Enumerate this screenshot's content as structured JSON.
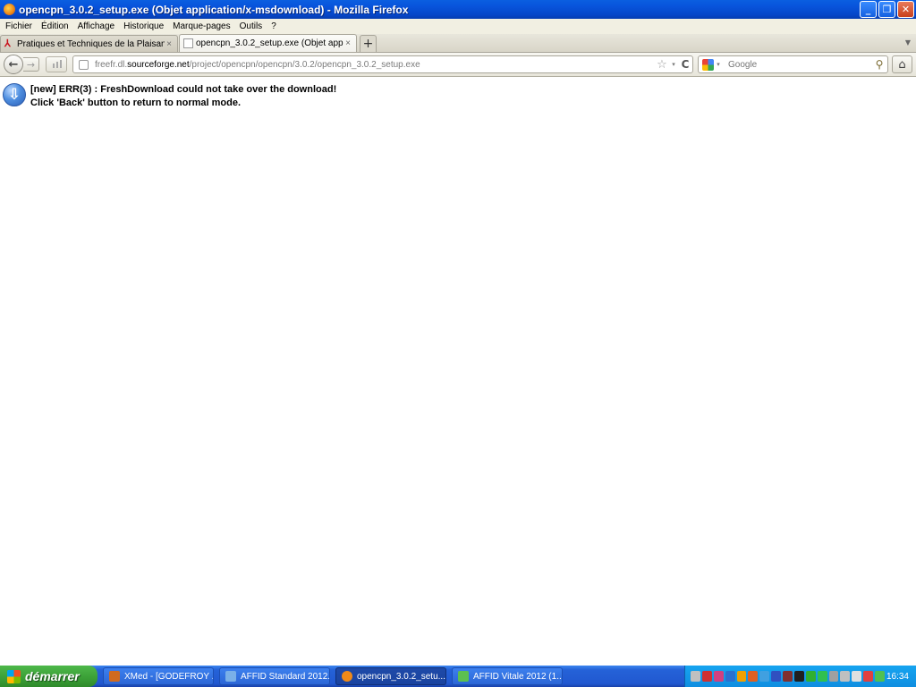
{
  "window": {
    "title": "opencpn_3.0.2_setup.exe (Objet application/x-msdownload) - Mozilla Firefox",
    "minimize": "_",
    "restore": "❐",
    "close": "✕"
  },
  "menu": {
    "items": [
      "Fichier",
      "Édition",
      "Affichage",
      "Historique",
      "Marque-pages",
      "Outils",
      "?"
    ]
  },
  "tabs": [
    {
      "label": "Pratiques et Techniques de la Plaisance",
      "close": "×",
      "active": false
    },
    {
      "label": "opencpn_3.0.2_setup.exe (Objet applica...",
      "close": "×",
      "active": true
    }
  ],
  "new_tab": "+",
  "tab_list": "▼",
  "nav": {
    "back": "←",
    "forward": "→",
    "url_prefix": "freefr.dl.",
    "url_domain": "sourceforge.net",
    "url_path": "/project/opencpn/opencpn/3.0.2/opencpn_3.0.2_setup.exe",
    "star": "☆",
    "dropdown": "▾",
    "reload": "C",
    "search_placeholder": "Google",
    "search_icon": "magnifier-icon",
    "home": "⌂"
  },
  "content": {
    "icon": "download-arrow-icon",
    "line1": "[new] ERR(3) : FreshDownload could not take over the download!",
    "line2": "Click 'Back' button to return to normal mode."
  },
  "taskbar": {
    "start_label": "démarrer",
    "tasks": [
      {
        "label": "XMed - [GODEFROY ...",
        "active": false,
        "icon_color": "#d06a20"
      },
      {
        "label": "AFFID Standard 2012...",
        "active": false,
        "icon_color": "#7ab0e8"
      },
      {
        "label": "opencpn_3.0.2_setu...",
        "active": true,
        "icon_color": "#f08a18"
      },
      {
        "label": "AFFID Vitale 2012 (1....",
        "active": false,
        "icon_color": "#5cc050"
      }
    ],
    "tray_icon_colors": [
      "#c0c0c0",
      "#d03030",
      "#d04080",
      "#2a70d0",
      "#f0a000",
      "#e06020",
      "#40a0e0",
      "#3050c0",
      "#803030",
      "#202020",
      "#30b030",
      "#30c050",
      "#a0a0a0",
      "#c0c0c0",
      "#e0e0e0",
      "#e04040",
      "#50c050"
    ],
    "clock": "16:34"
  }
}
